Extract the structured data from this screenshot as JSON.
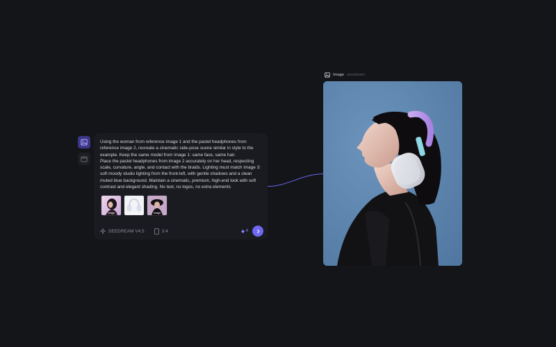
{
  "prompt": {
    "text": "Using the woman from reference image 1 and the pastel headphones from reference image 2, recreate a cinematic side-pose scene similar in style to the example. Keep the same model from image 1: same face, same hair.\nPlace the pastel headphones from image 2 accurately on her head, respecting scale, curvature, angle, and contact with the braids. Lighting must match image 3: soft moody studio lighting from the front-left, with gentle shadows and a clean muted blue background. Maintain a cinematic, premium, high-end look with soft contrast and elegant shading. No text, no logos, no extra elements"
  },
  "references": [
    {
      "label": "Image"
    },
    {
      "label": "Image"
    },
    {
      "label": "Image"
    }
  ],
  "footer": {
    "model": "SEEDREAM V4.5",
    "ratio": "3:4",
    "count": "4"
  },
  "output": {
    "title": "Image",
    "subtitle": "seedream"
  },
  "colors": {
    "accent": "#6f68f2",
    "accent_dark": "#3d3789",
    "background": "#141519",
    "card": "#1a1b20",
    "output_bg": "#5f86ad"
  },
  "icons": {
    "rail_image": "image-icon",
    "rail_video": "video-icon",
    "model": "sparkle-icon",
    "ratio": "aspect-ratio-icon",
    "count": "diamond-icon",
    "send": "chevron-right-icon",
    "node": "image-icon"
  }
}
